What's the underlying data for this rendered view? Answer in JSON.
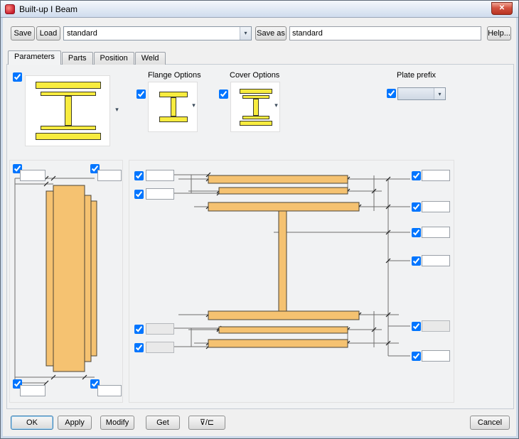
{
  "window": {
    "title": "Built-up I Beam"
  },
  "icons": {
    "dropdown_arrow": "▾",
    "close": "✕"
  },
  "toolbar": {
    "save_label": "Save",
    "load_label": "Load",
    "preset_value": "standard",
    "save_as_label": "Save as",
    "save_as_value": "standard",
    "help_label": "Help..."
  },
  "tabs": {
    "items": [
      {
        "label": "Parameters",
        "active": true
      },
      {
        "label": "Parts",
        "active": false
      },
      {
        "label": "Position",
        "active": false
      },
      {
        "label": "Weld",
        "active": false
      }
    ]
  },
  "sections": {
    "flange_options_label": "Flange Options",
    "cover_options_label": "Cover Options",
    "plate_prefix_label": "Plate prefix"
  },
  "footer": {
    "ok_label": "OK",
    "apply_label": "Apply",
    "modify_label": "Modify",
    "get_label": "Get",
    "toggle_label": "⊽/⊏",
    "cancel_label": "Cancel"
  },
  "colors": {
    "beam_yellow": "#f8ec3f",
    "beam_orange": "#f5c271",
    "titlebar_top": "#f4f7fb",
    "titlebar_bottom": "#cfdcee",
    "close_red": "#b83322"
  }
}
